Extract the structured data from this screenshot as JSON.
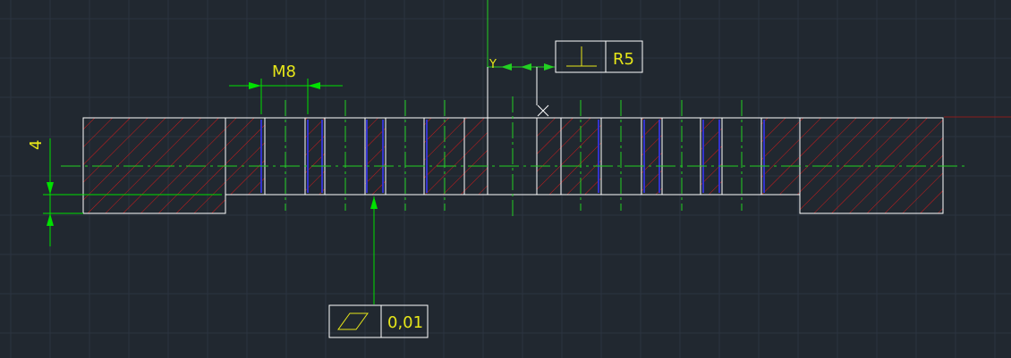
{
  "drawing": {
    "dimension_label": "M8",
    "vertical_dimension_label": "4",
    "ucs_y_label": "Y",
    "ucs_x_label": "X",
    "flatness_tolerance_value": "0,01",
    "perpendicularity_tolerance_value": "R5"
  },
  "icons": {
    "flatness": "flatness-symbol-icon",
    "perpendicularity": "perpendicularity-symbol-icon"
  },
  "colors": {
    "background": "#212830",
    "grid": "#2c3440",
    "outline": "#ffffff",
    "hatch": "#d11a1a",
    "thread": "#3333cc",
    "centerline": "#22d022",
    "dimension": "#00e000",
    "text": "#e6e619",
    "axis_red": "#8b1c1c"
  }
}
